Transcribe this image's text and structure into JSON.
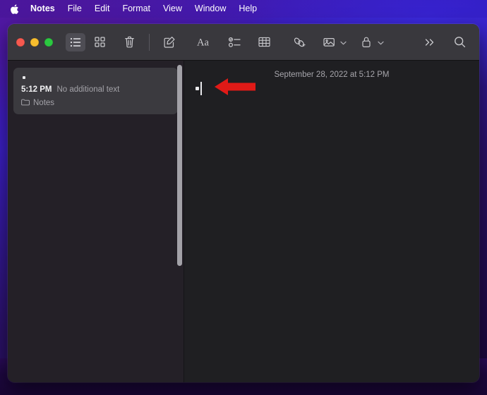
{
  "menubar": {
    "apple_icon": "apple-logo-icon",
    "items": [
      {
        "label": "Notes",
        "bold": true
      },
      {
        "label": "File",
        "bold": false
      },
      {
        "label": "Edit",
        "bold": false
      },
      {
        "label": "Format",
        "bold": false
      },
      {
        "label": "View",
        "bold": false
      },
      {
        "label": "Window",
        "bold": false
      },
      {
        "label": "Help",
        "bold": false
      }
    ]
  },
  "window": {
    "app": "Notes",
    "traffic_lights": {
      "close": "#f6594f",
      "minimize": "#f7bd2e",
      "zoom": "#2bc840"
    }
  },
  "toolbar": {
    "items": [
      {
        "name": "list-view-icon",
        "label": "List View",
        "active": true
      },
      {
        "name": "gallery-view-icon",
        "label": "Gallery View",
        "active": false
      },
      {
        "name": "trash-icon",
        "label": "Delete Note",
        "active": false
      },
      {
        "name": "compose-icon",
        "label": "New Note",
        "active": false
      },
      {
        "name": "format-aa-icon",
        "label": "Aa",
        "active": false
      },
      {
        "name": "checklist-icon",
        "label": "Checklist",
        "active": false
      },
      {
        "name": "table-icon",
        "label": "Table",
        "active": false
      },
      {
        "name": "link-icon",
        "label": "Add Link",
        "active": false
      },
      {
        "name": "media-icon",
        "label": "Media",
        "active": false,
        "chevron": true
      },
      {
        "name": "lock-icon",
        "label": "Lock Note",
        "active": false,
        "chevron": true
      },
      {
        "name": "overflow-icon",
        "label": "More",
        "active": false
      },
      {
        "name": "search-icon",
        "label": "Search",
        "active": false
      }
    ]
  },
  "sidebar": {
    "notes": [
      {
        "title": "",
        "time": "5:12 PM",
        "snippet": "No additional text",
        "folder": "Notes",
        "folder_icon": "folder-icon",
        "selected": true
      }
    ]
  },
  "content": {
    "date": "September 28, 2022 at 5:12 PM",
    "body_text": "",
    "bullet_present": true,
    "caret_visible": true
  },
  "annotation": {
    "arrow_color": "#e01a17",
    "arrow_direction": "left",
    "arrow_label": "pointer-arrow"
  }
}
